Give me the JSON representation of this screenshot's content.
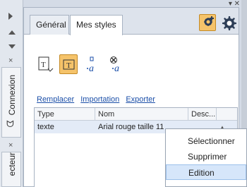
{
  "left_rail": {
    "tab_connexion": "Connexion",
    "tab_inspecteur": "ecteur"
  },
  "tabs": [
    {
      "label": "Général"
    },
    {
      "label": "Mes styles"
    }
  ],
  "links": [
    "Remplacer",
    "Importation",
    "Exporter"
  ],
  "table": {
    "headers": [
      "Type",
      "Nom",
      "Desc..."
    ],
    "rows": [
      {
        "type": "texte",
        "nom": "Arial rouge taille 11"
      }
    ]
  },
  "context_menu": [
    "Sélectionner",
    "Supprimer",
    "Edition"
  ],
  "colors": {
    "accent": "#f5c36a",
    "link": "#1a4ea8",
    "selection": "#d6e6fa"
  },
  "icons": [
    "add-style-icon",
    "gear-icon",
    "text-style-icon",
    "text-frame-icon",
    "character-style-icon",
    "remove-character-style-icon"
  ]
}
